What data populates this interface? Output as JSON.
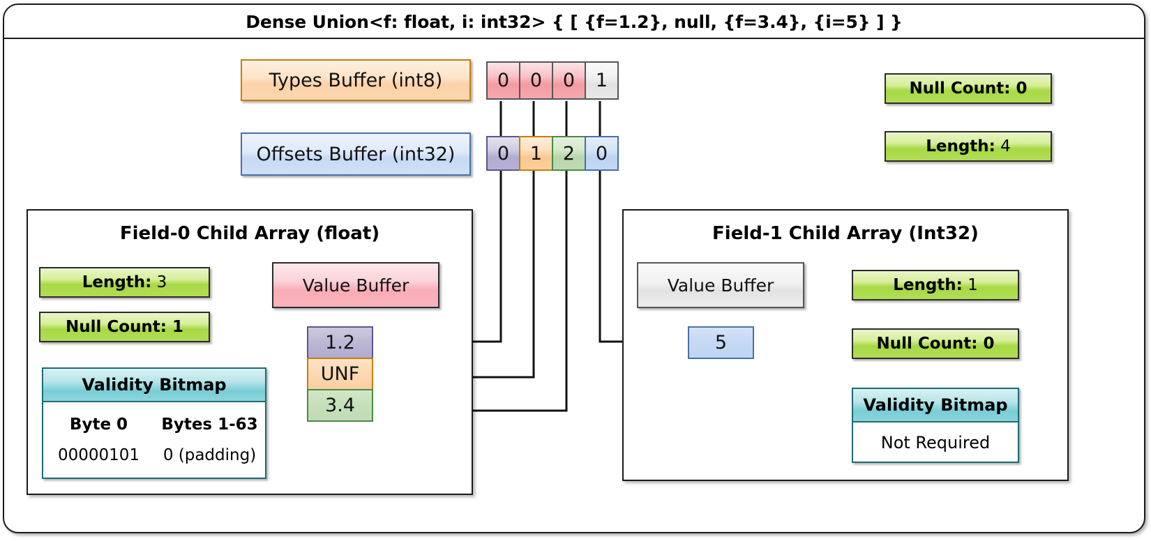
{
  "diagram": {
    "title": "Dense Union<f: float, i: int32> { [ {f=1.2}, null, {f=3.4}, {i=5} ] }"
  },
  "top": {
    "types_buffer_label": "Types Buffer (int8)",
    "offsets_buffer_label": "Offsets Buffer (int32)",
    "types_cells": [
      "0",
      "0",
      "0",
      "1"
    ],
    "offsets_cells": [
      "0",
      "1",
      "2",
      "0"
    ],
    "null_count_label": "Null Count: 0",
    "length_label": "Length:",
    "length_value": "4"
  },
  "field0": {
    "title": "Field-0 Child Array (float)",
    "length_label": "Length:",
    "length_value": "3",
    "null_count_label": "Null Count: 1",
    "value_buffer_label": "Value Buffer",
    "values": [
      "1.2",
      "UNF",
      "3.4"
    ],
    "validity": {
      "header": "Validity Bitmap",
      "columns": [
        "Byte 0",
        "Bytes 1-63"
      ],
      "row": [
        "00000101",
        "0 (padding)"
      ]
    }
  },
  "field1": {
    "title": "Field-1 Child Array (Int32)",
    "value_buffer_label": "Value Buffer",
    "values": [
      "5"
    ],
    "length_label": "Length:",
    "length_value": "1",
    "null_count_label": "Null Count: 0",
    "validity": {
      "header": "Validity Bitmap",
      "body": "Not Required"
    }
  },
  "colors": {
    "types_cell_red": "#f6a8ae",
    "types_cell_grey": "#e8e8e8",
    "offset_cell_purple": "#b6b2d6",
    "offset_cell_orange": "#fbd0a0",
    "offset_cell_green": "#bfdcb4",
    "offset_cell_blue": "#c4d9f2",
    "value_purple": "#b6b2d6",
    "value_orange": "#fbd8b0",
    "value_green": "#c3dfb6",
    "value_blue": "#bdd6f3",
    "green_badge": "#a7d945",
    "teal_header": "#79cdd6",
    "orange_border": "#c87d07",
    "blue_border": "#4a6fa8"
  }
}
